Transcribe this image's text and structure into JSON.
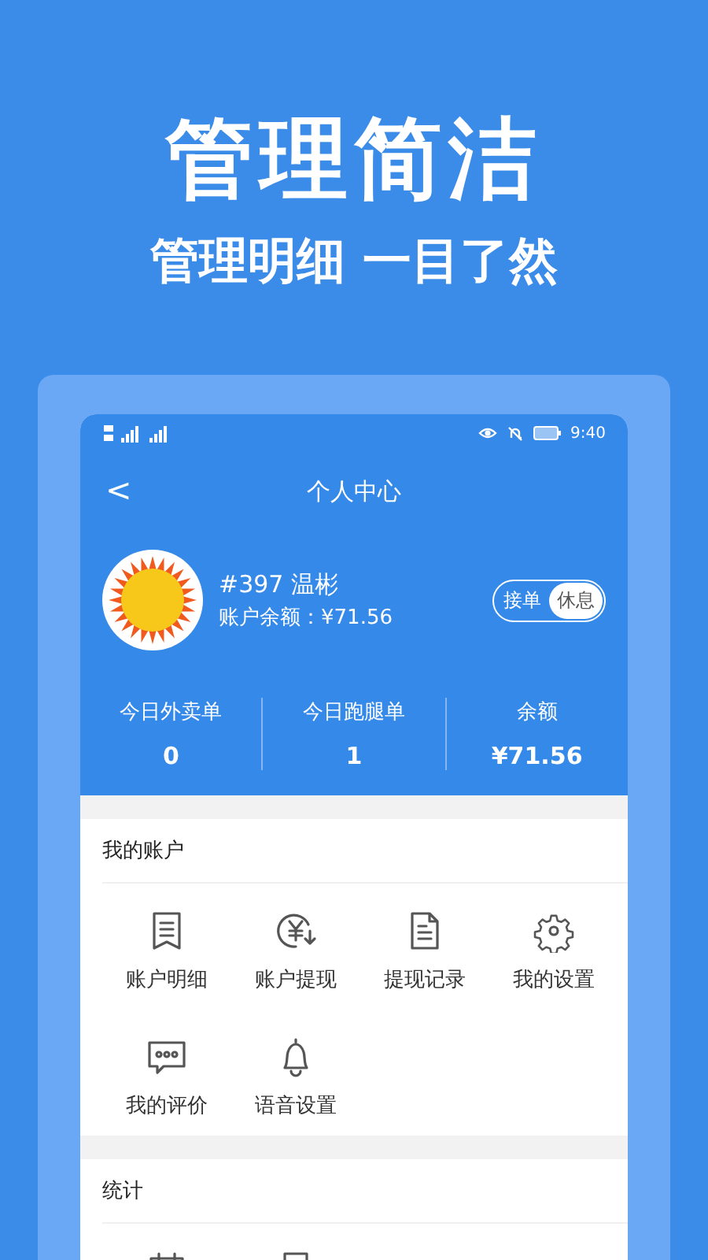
{
  "headline": "管理简洁",
  "subheadline": "管理明细 一目了然",
  "status_bar": {
    "time": "9:40"
  },
  "nav": {
    "back": "<",
    "title": "个人中心"
  },
  "profile": {
    "name": "#397 温彬",
    "balance": "账户余额：¥71.56",
    "mode_toggle": [
      {
        "label": "接单",
        "selected": false
      },
      {
        "label": "休息",
        "selected": true
      }
    ]
  },
  "stats": [
    {
      "label": "今日外卖单",
      "value": "0"
    },
    {
      "label": "今日跑腿单",
      "value": "1"
    },
    {
      "label": "余额",
      "value": "¥71.56"
    }
  ],
  "sections": [
    {
      "title": "我的账户",
      "items": [
        {
          "label": "账户明细"
        },
        {
          "label": "账户提现"
        },
        {
          "label": "提现记录"
        },
        {
          "label": "我的设置"
        },
        {
          "label": "我的评价"
        },
        {
          "label": "语音设置"
        }
      ]
    },
    {
      "title": "统计"
    }
  ]
}
